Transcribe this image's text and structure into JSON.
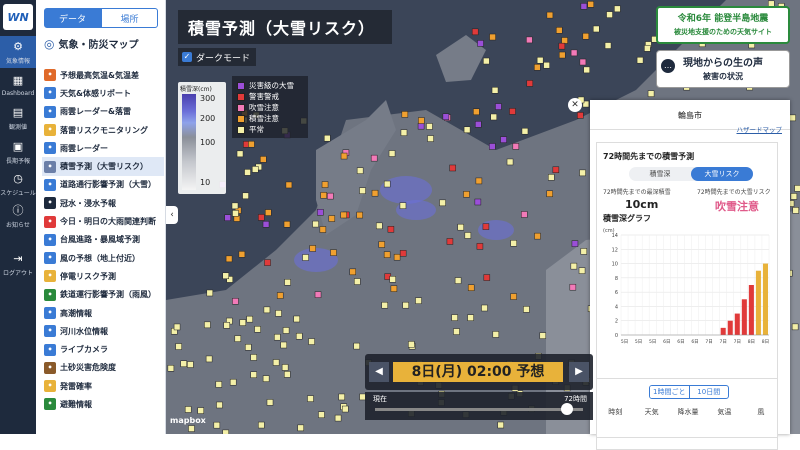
{
  "rail": {
    "logo": "WN",
    "items": [
      {
        "label": "気象情報",
        "icon": "gear-icon"
      },
      {
        "label": "Dashboard",
        "icon": "dashboard-icon"
      },
      {
        "label": "観測値",
        "icon": "chart-icon"
      },
      {
        "label": "長期予報",
        "icon": "calendar-icon"
      },
      {
        "label": "スケジュール",
        "icon": "schedule-icon"
      },
      {
        "label": "お知らせ",
        "icon": "info-icon"
      },
      {
        "label": "ログアウト",
        "icon": "logout-icon"
      }
    ]
  },
  "menu": {
    "tabs": [
      "データ",
      "場所"
    ],
    "title": "気象・防災マップ",
    "items": [
      {
        "label": "予想最高気温&気温差",
        "color": "#e06a2a"
      },
      {
        "label": "天気&体感リポート",
        "color": "#3a7bd5"
      },
      {
        "label": "雨雲レーダー&落雷",
        "color": "#3a7bd5"
      },
      {
        "label": "落雷リスクモニタリング",
        "color": "#e8b23a"
      },
      {
        "label": "雨雲レーダー",
        "color": "#3a7bd5"
      },
      {
        "label": "積雪予測（大雪リスク）",
        "color": "#6b7fa8"
      },
      {
        "label": "道路通行影響予測（大雪）",
        "color": "#3a7bd5"
      },
      {
        "label": "冠水・浸水予報",
        "color": "#1e2a3d"
      },
      {
        "label": "今日・明日の大雨関連判断",
        "color": "#e03a3a"
      },
      {
        "label": "台風進路・暴風域予測",
        "color": "#3a7bd5"
      },
      {
        "label": "風の予想（地上付近）",
        "color": "#3a7bd5"
      },
      {
        "label": "停電リスク予測",
        "color": "#e8b23a"
      },
      {
        "label": "鉄道運行影響予測（雨風）",
        "color": "#2a8a3c"
      },
      {
        "label": "高潮情報",
        "color": "#3a7bd5"
      },
      {
        "label": "河川水位情報",
        "color": "#3a7bd5"
      },
      {
        "label": "ライブカメラ",
        "color": "#3a7bd5"
      },
      {
        "label": "土砂災害危険度",
        "color": "#8a5a2a"
      },
      {
        "label": "発雷確率",
        "color": "#e8b23a"
      },
      {
        "label": "避難情報",
        "color": "#2a8a3c"
      }
    ]
  },
  "map": {
    "title": "積雪予測（大雪リスク）",
    "dark_mode_label": "ダークモード",
    "dark_mode_checked": true,
    "scale": {
      "title": "積雪深(cm)",
      "ticks": [
        "300",
        "200",
        "100",
        "10"
      ]
    },
    "legend": [
      {
        "label": "災害級の大雪",
        "color": "#9b4fd8"
      },
      {
        "label": "警害警戒",
        "color": "#e03a3a"
      },
      {
        "label": "吹雪注意",
        "color": "#f27ab8"
      },
      {
        "label": "積雪注意",
        "color": "#f0a030"
      },
      {
        "label": "平常",
        "color": "#f4f0a8"
      }
    ],
    "attribution": "mapbox"
  },
  "promos": {
    "p1_line1": "令和6年 能登半島地震",
    "p1_line2": "被災地支援のための天気サイト",
    "p2_line1": "現地からの生の声",
    "p2_line2": "被害の状況"
  },
  "panel": {
    "location": "輪島市",
    "hazard_link": "ハザードマップ",
    "card_title": "72時間先までの積雪予測",
    "toggle": [
      "積雪深",
      "大雪リスク"
    ],
    "stat1_label": "72時間先までの最深積雪",
    "stat1_value": "10cm",
    "stat2_label": "72時間先までの大雪リスク",
    "stat2_value": "吹雪注意",
    "graph_title": "積雪深グラフ",
    "table_toggle": [
      "1時間ごと",
      "10日間"
    ],
    "table_headers": [
      "時刻",
      "天気",
      "降水量",
      "気温",
      "風"
    ]
  },
  "timebar": {
    "current": "8日(月) 02:00 予想",
    "left_label": "現在",
    "right_label": "72時間"
  },
  "chart_data": {
    "type": "bar",
    "ylabel": "(cm)",
    "ylim": [
      0,
      14
    ],
    "yticks": [
      0,
      2,
      4,
      6,
      8,
      10,
      12,
      14
    ],
    "categories": [
      "5日",
      "5日",
      "5日",
      "5日",
      "5日",
      "5日",
      "6日",
      "6日",
      "6日",
      "6日",
      "6日",
      "6日",
      "7日",
      "7日",
      "7日",
      "7日",
      "7日",
      "7日",
      "8日",
      "8日",
      "8日"
    ],
    "values": [
      0,
      0,
      0,
      0,
      0,
      0,
      0,
      0,
      0,
      0,
      0,
      0,
      0,
      0,
      1,
      2,
      3,
      5,
      7,
      9,
      10
    ],
    "colors": [
      "#e03a3a",
      "#e03a3a",
      "#e03a3a",
      "#e03a3a",
      "#e03a3a",
      "#e03a3a",
      "#e03a3a",
      "#e03a3a",
      "#e03a3a",
      "#e03a3a",
      "#e03a3a",
      "#e03a3a",
      "#e03a3a",
      "#e03a3a",
      "#e03a3a",
      "#e03a3a",
      "#e03a3a",
      "#e03a3a",
      "#e03a3a",
      "#e8b23a",
      "#e8b23a"
    ]
  }
}
